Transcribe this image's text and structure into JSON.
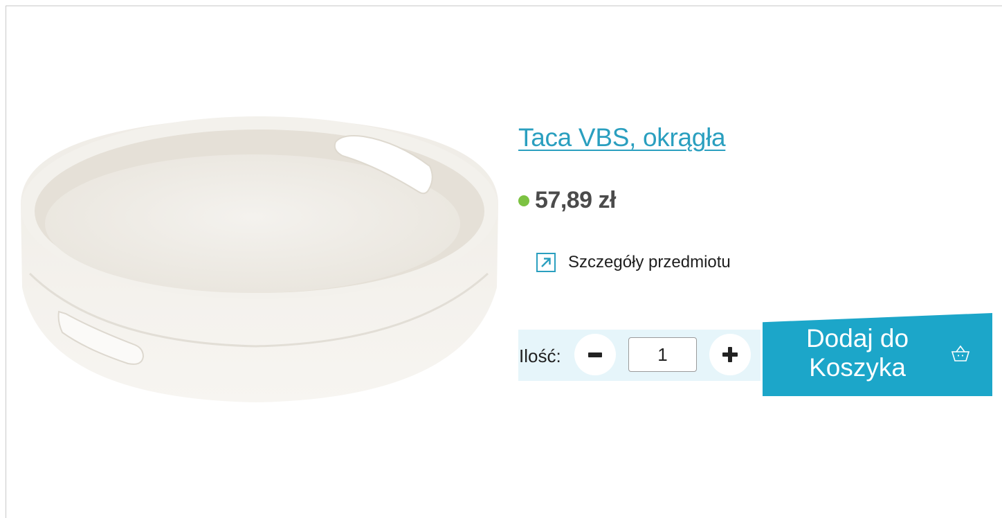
{
  "product": {
    "title": "Taca VBS, okrągła",
    "price": "57,89 zł",
    "details_link": "Szczegóły przedmiotu",
    "image_alt": "Taca VBS, okrągła"
  },
  "purchase": {
    "quantity_label": "Ilość:",
    "quantity_value": "1",
    "add_to_cart_label": "Dodaj do Koszyka"
  },
  "icons": {
    "stock": "in-stock-dot",
    "details": "external-link-arrow-icon",
    "decrease": "minus-icon",
    "increase": "plus-icon",
    "cart": "basket-icon"
  },
  "colors": {
    "accent": "#2a9fbf",
    "cart_button": "#1ca6c9",
    "stock_indicator": "#7cc242",
    "quantity_strip": "#e6f5fa",
    "price_text": "#4b4b4b"
  }
}
